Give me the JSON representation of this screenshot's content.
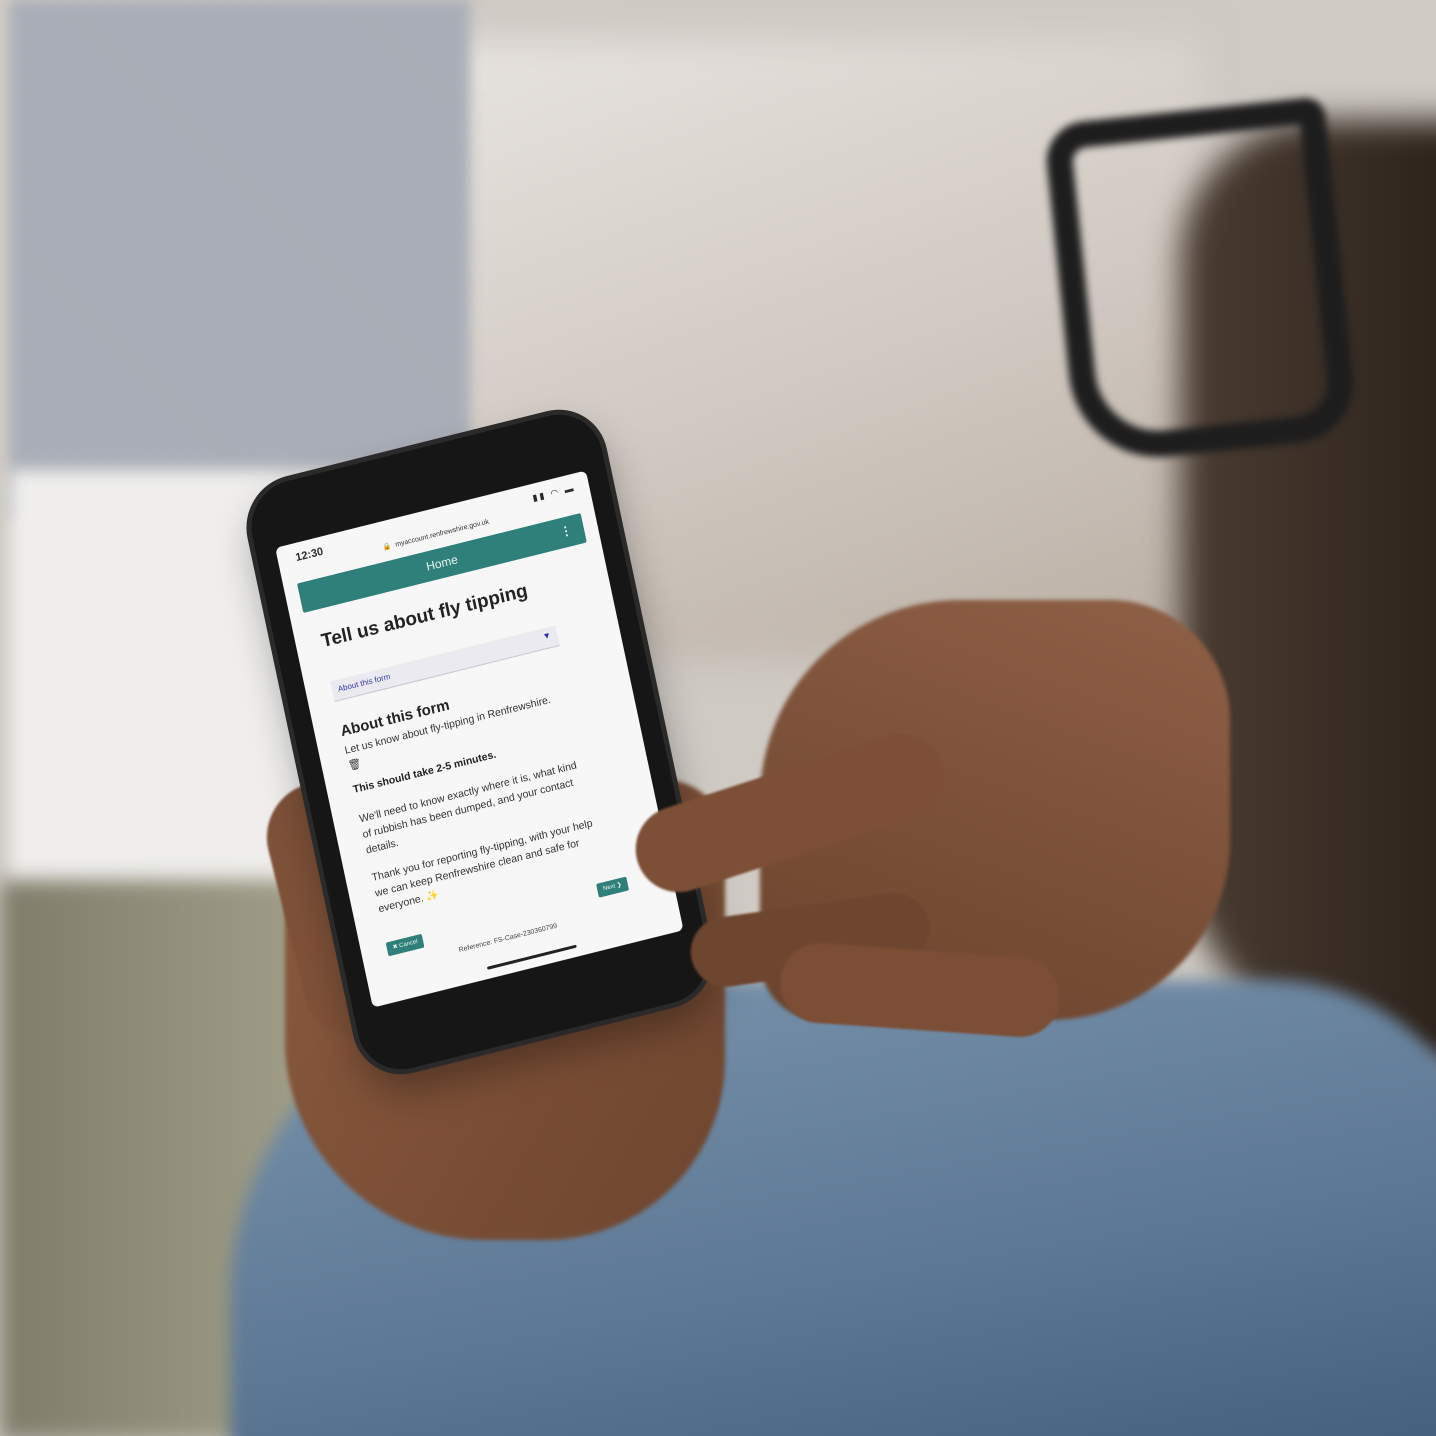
{
  "status_bar": {
    "time": "12:30",
    "icons": "▮▮ ◠ ▬",
    "url": "myaccount.renfrewshire.gov.uk"
  },
  "nav": {
    "home_label": "Home",
    "menu_glyph": "⋮"
  },
  "page": {
    "title": "Tell us about fly tipping",
    "section_select": {
      "selected": "About this form",
      "caret_glyph": "▾"
    },
    "heading": "About this form",
    "intro": "Let us know about fly-tipping in Renfrewshire. 🗑",
    "duration": "This should take 2-5 minutes.",
    "details": "We'll need to know exactly where it is, what kind of rubbish has been dumped, and your contact details.",
    "thanks": "Thank you for reporting fly-tipping, with your help we can keep Renfrewshire clean and safe for everyone. ✨"
  },
  "actions": {
    "cancel_label": "✖ Cancel",
    "next_label": "Next ❯"
  },
  "reference": "Reference: FS-Case-230360799",
  "colors": {
    "accent": "#2f7f7a",
    "select_text": "#3a3ab0"
  }
}
